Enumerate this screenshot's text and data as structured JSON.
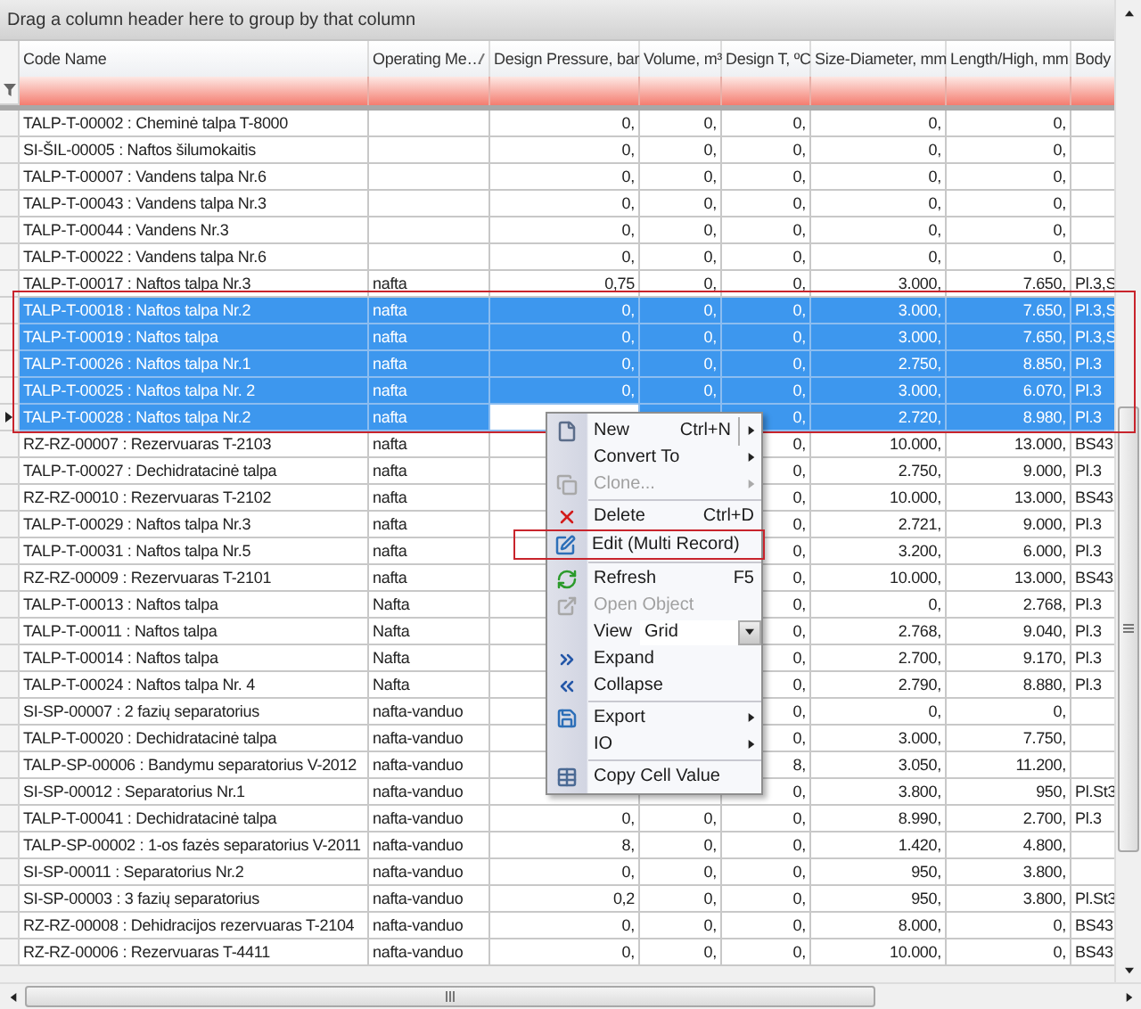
{
  "group_panel": {
    "text": "Drag a column header here to group by that column"
  },
  "columns": [
    {
      "label": "Code Name",
      "sorted": false
    },
    {
      "label": "Operating Me…",
      "sorted": true
    },
    {
      "label": "Design Pressure, bar",
      "sorted": false
    },
    {
      "label": "Volume, m³",
      "sorted": false
    },
    {
      "label": "Design T, ºC",
      "sorted": false
    },
    {
      "label": "Size-Diameter, mm",
      "sorted": false
    },
    {
      "label": "Length/High, mm",
      "sorted": false
    },
    {
      "label": "Body",
      "sorted": false
    }
  ],
  "rows": [
    {
      "code_name": "TALP-T-00002 : Cheminė talpa T-8000",
      "pressure": "0,",
      "volume": "0,",
      "temp": "0,",
      "diameter": "0,",
      "length": "0,",
      "selected": false,
      "current": false
    },
    {
      "code_name": "SI-ŠIL-00005 : Naftos šilumokaitis",
      "pressure": "0,",
      "volume": "0,",
      "temp": "0,",
      "diameter": "0,",
      "length": "0,",
      "selected": false,
      "current": false
    },
    {
      "code_name": "TALP-T-00007 : Vandens talpa Nr.6",
      "pressure": "0,",
      "volume": "0,",
      "temp": "0,",
      "diameter": "0,",
      "length": "0,",
      "selected": false,
      "current": false
    },
    {
      "code_name": "TALP-T-00043 : Vandens talpa Nr.3",
      "pressure": "0,",
      "volume": "0,",
      "temp": "0,",
      "diameter": "0,",
      "length": "0,",
      "selected": false,
      "current": false
    },
    {
      "code_name": "TALP-T-00044 : Vandens Nr.3",
      "pressure": "0,",
      "volume": "0,",
      "temp": "0,",
      "diameter": "0,",
      "length": "0,",
      "selected": false,
      "current": false
    },
    {
      "code_name": "TALP-T-00022 : Vandens talpa Nr.6",
      "pressure": "0,",
      "volume": "0,",
      "temp": "0,",
      "diameter": "0,",
      "length": "0,",
      "selected": false,
      "current": false
    },
    {
      "code_name": "TALP-T-00017 : Naftos talpa Nr.3",
      "medium": "nafta",
      "pressure": "0,75",
      "volume": "0,",
      "temp": "0,",
      "diameter": "3.000,",
      "length": "7.650,",
      "body": "Pl.3,S",
      "selected": false,
      "current": false
    },
    {
      "code_name": "TALP-T-00018 : Naftos talpa Nr.2",
      "medium": "nafta",
      "pressure": "0,",
      "volume": "0,",
      "temp": "0,",
      "diameter": "3.000,",
      "length": "7.650,",
      "body": "Pl.3,S",
      "selected": true,
      "current": false
    },
    {
      "code_name": "TALP-T-00019 : Naftos talpa",
      "medium": "nafta",
      "pressure": "0,",
      "volume": "0,",
      "temp": "0,",
      "diameter": "3.000,",
      "length": "7.650,",
      "body": "Pl.3,S",
      "selected": true,
      "current": false
    },
    {
      "code_name": "TALP-T-00026 : Naftos talpa Nr.1",
      "medium": "nafta",
      "pressure": "0,",
      "volume": "0,",
      "temp": "0,",
      "diameter": "2.750,",
      "length": "8.850,",
      "body": "Pl.3",
      "selected": true,
      "current": false
    },
    {
      "code_name": "TALP-T-00025 : Naftos talpa Nr. 2",
      "medium": "nafta",
      "pressure": "0,",
      "volume": "0,",
      "temp": "0,",
      "diameter": "3.000,",
      "length": "6.070,",
      "body": "Pl.3",
      "selected": true,
      "current": false
    },
    {
      "code_name": "TALP-T-00028 : Naftos talpa Nr.2",
      "medium": "nafta",
      "temp": "0,",
      "diameter": "2.720,",
      "length": "8.980,",
      "body": "Pl.3",
      "selected": true,
      "current": true
    },
    {
      "code_name": "RZ-RZ-00007 : Rezervuaras T-2103",
      "medium": "nafta",
      "temp": "0,",
      "diameter": "10.000,",
      "length": "13.000,",
      "body": "BS43",
      "selected": false,
      "current": false
    },
    {
      "code_name": "TALP-T-00027 : Dechidratacinė talpa",
      "medium": "nafta",
      "temp": "0,",
      "diameter": "2.750,",
      "length": "9.000,",
      "body": "Pl.3",
      "selected": false,
      "current": false
    },
    {
      "code_name": "RZ-RZ-00010 : Rezervuaras T-2102",
      "medium": "nafta",
      "temp": "0,",
      "diameter": "10.000,",
      "length": "13.000,",
      "body": "BS43",
      "selected": false,
      "current": false
    },
    {
      "code_name": "TALP-T-00029 : Naftos talpa Nr.3",
      "medium": "nafta",
      "temp": "0,",
      "diameter": "2.721,",
      "length": "9.000,",
      "body": "Pl.3",
      "selected": false,
      "current": false
    },
    {
      "code_name": "TALP-T-00031 : Naftos talpa Nr.5",
      "medium": "nafta",
      "temp": "0,",
      "diameter": "3.200,",
      "length": "6.000,",
      "body": "Pl.3",
      "selected": false,
      "current": false
    },
    {
      "code_name": "RZ-RZ-00009 : Rezervuaras T-2101",
      "medium": "nafta",
      "temp": "0,",
      "diameter": "10.000,",
      "length": "13.000,",
      "body": "BS43",
      "selected": false,
      "current": false
    },
    {
      "code_name": "TALP-T-00013 : Naftos talpa",
      "medium": "Nafta",
      "temp": "0,",
      "diameter": "0,",
      "length": "2.768,",
      "body": "Pl.3",
      "selected": false,
      "current": false
    },
    {
      "code_name": "TALP-T-00011 : Naftos talpa",
      "medium": "Nafta",
      "temp": "0,",
      "diameter": "2.768,",
      "length": "9.040,",
      "body": "Pl.3",
      "selected": false,
      "current": false
    },
    {
      "code_name": "TALP-T-00014 : Naftos talpa",
      "medium": "Nafta",
      "temp": "0,",
      "diameter": "2.700,",
      "length": "9.170,",
      "body": "Pl.3",
      "selected": false,
      "current": false
    },
    {
      "code_name": "TALP-T-00024 : Naftos talpa Nr. 4",
      "medium": "Nafta",
      "temp": "0,",
      "diameter": "2.790,",
      "length": "8.880,",
      "body": "Pl.3",
      "selected": false,
      "current": false
    },
    {
      "code_name": "SI-SP-00007 : 2 fazių separatorius",
      "medium": "nafta-vanduo",
      "temp": "0,",
      "diameter": "0,",
      "length": "0,",
      "selected": false,
      "current": false
    },
    {
      "code_name": "TALP-T-00020 : Dechidratacinė talpa",
      "medium": "nafta-vanduo",
      "temp": "0,",
      "diameter": "3.000,",
      "length": "7.750,",
      "selected": false,
      "current": false
    },
    {
      "code_name": "TALP-SP-00006 : Bandymu separatorius V-2012",
      "medium": "nafta-vanduo",
      "temp": "8,",
      "diameter": "3.050,",
      "length": "11.200,",
      "selected": false,
      "current": false
    },
    {
      "code_name": "SI-SP-00012 : Separatorius Nr.1",
      "medium": "nafta-vanduo",
      "temp": "0,",
      "diameter": "3.800,",
      "length": "950,",
      "body": "Pl.St3",
      "selected": false,
      "current": false
    },
    {
      "code_name": "TALP-T-00041 : Dechidratacinė talpa",
      "medium": "nafta-vanduo",
      "pressure": "0,",
      "volume": "0,",
      "temp": "0,",
      "diameter": "8.990,",
      "length": "2.700,",
      "body": "Pl.3",
      "selected": false,
      "current": false
    },
    {
      "code_name": "TALP-SP-00002 : 1-os fazės separatorius V-2011",
      "medium": "nafta-vanduo",
      "pressure": "8,",
      "volume": "0,",
      "temp": "0,",
      "diameter": "1.420,",
      "length": "4.800,",
      "selected": false,
      "current": false
    },
    {
      "code_name": "SI-SP-00011 : Separatorius Nr.2",
      "medium": "nafta-vanduo",
      "pressure": "0,",
      "volume": "0,",
      "temp": "0,",
      "diameter": "950,",
      "length": "3.800,",
      "selected": false,
      "current": false
    },
    {
      "code_name": "SI-SP-00003 : 3 fazių separatorius",
      "medium": "nafta-vanduo",
      "pressure": "0,2",
      "volume": "0,",
      "temp": "0,",
      "diameter": "950,",
      "length": "3.800,",
      "body": "Pl.St3",
      "selected": false,
      "current": false
    },
    {
      "code_name": "RZ-RZ-00008 : Dehidracijos rezervuaras T-2104",
      "medium": "nafta-vanduo",
      "pressure": "0,",
      "volume": "0,",
      "temp": "0,",
      "diameter": "8.000,",
      "length": "0,",
      "body": "BS43",
      "selected": false,
      "current": false
    },
    {
      "code_name": "RZ-RZ-00006 : Rezervuaras T-4411",
      "medium": "nafta-vanduo",
      "pressure": "0,",
      "volume": "0,",
      "temp": "0,",
      "diameter": "10.000,",
      "length": "0,",
      "body": "BS43",
      "selected": false,
      "current": false
    }
  ],
  "context_menu": [
    {
      "kind": "item",
      "label": "New",
      "shortcut": "Ctrl+N",
      "submenu": true,
      "disabled": false
    },
    {
      "kind": "item",
      "label": "Convert To",
      "submenu": true,
      "disabled": false
    },
    {
      "kind": "item",
      "label": "Clone...",
      "submenu": true,
      "disabled": true
    },
    {
      "kind": "separator"
    },
    {
      "kind": "item",
      "label": "Delete",
      "shortcut": "Ctrl+D",
      "submenu": false,
      "disabled": false
    },
    {
      "kind": "item",
      "label": "Edit (Multi Record)",
      "submenu": false,
      "disabled": false
    },
    {
      "kind": "separator"
    },
    {
      "kind": "item",
      "label": "Refresh",
      "shortcut": "F5",
      "submenu": false,
      "disabled": false
    },
    {
      "kind": "item",
      "label": "Open Object",
      "submenu": false,
      "disabled": true
    },
    {
      "kind": "view",
      "label": "View",
      "value": "Grid"
    },
    {
      "kind": "item",
      "label": "Expand",
      "submenu": false,
      "disabled": false
    },
    {
      "kind": "item",
      "label": "Collapse",
      "submenu": false,
      "disabled": false
    },
    {
      "kind": "separator"
    },
    {
      "kind": "item",
      "label": "Export",
      "submenu": true,
      "disabled": false
    },
    {
      "kind": "item",
      "label": "IO",
      "submenu": true,
      "disabled": false
    },
    {
      "kind": "separator"
    },
    {
      "kind": "item",
      "label": "Copy Cell Value",
      "submenu": false,
      "disabled": false
    }
  ]
}
